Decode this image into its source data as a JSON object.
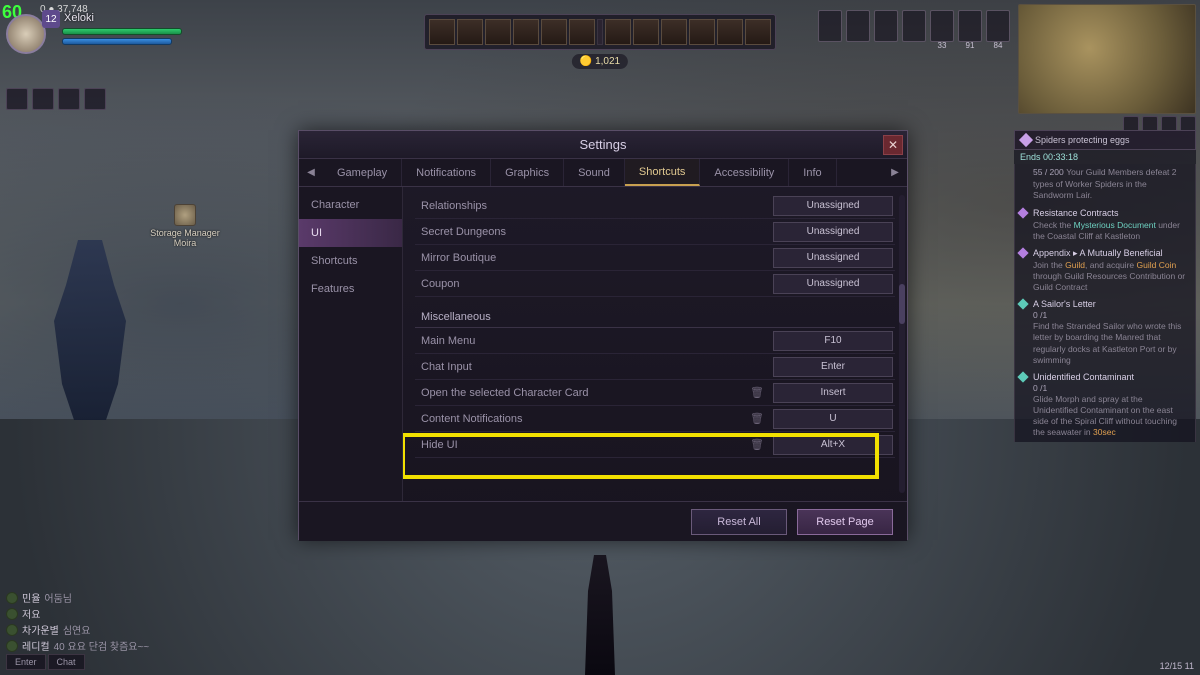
{
  "hud": {
    "fps": "60",
    "top_stat": "0   ● 37,748",
    "level": "12",
    "char_name": "Xeloki",
    "currency": "🟡 1,021",
    "equip_counts": [
      "",
      "",
      "",
      "",
      "33",
      "91",
      "84"
    ]
  },
  "npc": {
    "label": "Storage Manager Moira"
  },
  "settings": {
    "title": "Settings",
    "tabs": [
      "Gameplay",
      "Notifications",
      "Graphics",
      "Sound",
      "Shortcuts",
      "Accessibility",
      "Info"
    ],
    "active_tab": "Shortcuts",
    "side": [
      "Character",
      "UI",
      "Shortcuts",
      "Features"
    ],
    "active_side": "UI",
    "rows_top": [
      {
        "label": "Relationships",
        "key": "Unassigned",
        "trash": false
      },
      {
        "label": "Secret Dungeons",
        "key": "Unassigned",
        "trash": false
      },
      {
        "label": "Mirror Boutique",
        "key": "Unassigned",
        "trash": false
      },
      {
        "label": "Coupon",
        "key": "Unassigned",
        "trash": false
      }
    ],
    "section": "Miscellaneous",
    "rows_misc": [
      {
        "label": "Main Menu",
        "key": "F10",
        "trash": false
      },
      {
        "label": "Chat Input",
        "key": "Enter",
        "trash": false
      },
      {
        "label": "Open the selected Character Card",
        "key": "Insert",
        "trash": true
      },
      {
        "label": "Content Notifications",
        "key": "U",
        "trash": true
      },
      {
        "label": "Hide UI",
        "key": "Alt+X",
        "trash": true
      }
    ],
    "footer": {
      "reset_all": "Reset All",
      "reset_page": "Reset Page"
    }
  },
  "quests": {
    "event_title": "Spiders protecting eggs",
    "event_timer": "Ends   00:33:18",
    "event_progress": "55 / 200",
    "event_desc": "Your Guild Members defeat 2 types of Worker Spiders in the Sandworm Lair.",
    "q1_title": "Resistance Contracts",
    "q1_desc_a": "Check the ",
    "q1_desc_hl": "Mysterious Document",
    "q1_desc_b": " under the Coastal Cliff at Kastleton",
    "q2_title": "Appendix ▸ A Mutually Beneficial",
    "q2_desc_a": "Join the ",
    "q2_desc_hl": "Guild",
    "q2_desc_b": ", and acquire ",
    "q2_desc_hl2": "Guild Coin",
    "q2_desc_c": " through Guild Resources Contribution or Guild Contract",
    "q3_title": "A Sailor's Letter",
    "q3_count": "0 /1",
    "q3_desc": "Find the Stranded Sailor who wrote this letter by boarding the Manred that regularly docks at Kastleton Port or by swimming",
    "q4_title": "Unidentified Contaminant",
    "q4_count": "0 /1",
    "q4_desc_a": "Glide Morph and spray at the Unidentified Contaminant on the east side of the Spiral Cliff without touching the seawater in ",
    "q4_desc_hl": "30sec"
  },
  "chat": {
    "lines": [
      {
        "name": "민율",
        "msg": "어둠님"
      },
      {
        "name": "저요",
        "msg": ""
      },
      {
        "name": "차가운별",
        "msg": "심연요"
      },
      {
        "name": "레디컬",
        "msg": "40 요요 단검 찾즘요~~"
      }
    ],
    "tabs": [
      "Enter",
      "Chat"
    ]
  },
  "clock": "12/15 11"
}
